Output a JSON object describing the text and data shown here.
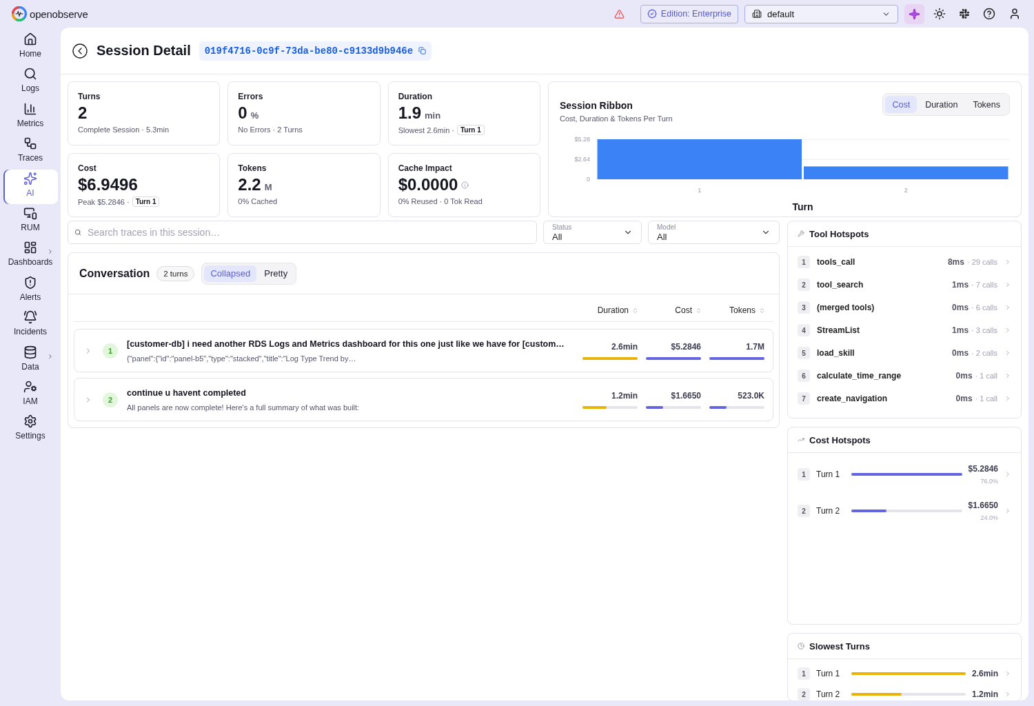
{
  "topbar": {
    "logo": "openobserve",
    "edition": "Edition: Enterprise",
    "organization": "default"
  },
  "sidebar": {
    "items": [
      {
        "label": "Home",
        "selected": false,
        "submenu": false
      },
      {
        "label": "Logs",
        "selected": false,
        "submenu": false
      },
      {
        "label": "Metrics",
        "selected": false,
        "submenu": false
      },
      {
        "label": "Traces",
        "selected": false,
        "submenu": false
      },
      {
        "label": "AI",
        "selected": true,
        "submenu": false
      },
      {
        "label": "RUM",
        "selected": false,
        "submenu": false
      },
      {
        "label": "Dashboards",
        "selected": false,
        "submenu": true
      },
      {
        "label": "Alerts",
        "selected": false,
        "submenu": false
      },
      {
        "label": "Incidents",
        "selected": false,
        "submenu": false
      },
      {
        "label": "Data",
        "selected": false,
        "submenu": true
      },
      {
        "label": "IAM",
        "selected": false,
        "submenu": false
      },
      {
        "label": "Settings",
        "selected": false,
        "submenu": false
      }
    ]
  },
  "header": {
    "title": "Session Detail",
    "session_id": "019f4716-0c9f-73da-be80-c9133d9b946e"
  },
  "stats": [
    {
      "label": "Turns",
      "value": "2",
      "detail": "Complete Session · 5.3min",
      "info": false
    },
    {
      "label": "Errors",
      "value": "0",
      "unit": "%",
      "detail": "No Errors · 2 Turns",
      "info": false
    },
    {
      "label": "Duration",
      "value": "1.9",
      "unit": "min",
      "detail": "Slowest 2.6min ·",
      "tag": "Turn 1",
      "info": false
    },
    {
      "label": "Cost",
      "value": "$6.9496",
      "detail": "Peak $5.2846 ·",
      "tag": "Turn 1",
      "info": false
    },
    {
      "label": "Tokens",
      "value": "2.2",
      "unit": "M",
      "detail": "0% Cached",
      "info": false
    },
    {
      "label": "Cache Impact",
      "value": "$0.0000",
      "detail": "0% Reused · 0 Tok Read",
      "info": true
    }
  ],
  "ribbon": {
    "title": "Session Ribbon",
    "subtitle": "Cost, Duration & Tokens Per Turn",
    "tabs": [
      {
        "label": "Cost",
        "selected": true
      },
      {
        "label": "Duration",
        "selected": false
      },
      {
        "label": "Tokens",
        "selected": false
      }
    ],
    "chart_data": {
      "type": "bar",
      "xlabel": "Turn",
      "categories": [
        "1",
        "2"
      ],
      "series": [
        {
          "color": "#3b82f6",
          "values": [
            5.3,
            1.7
          ]
        }
      ],
      "ylim": [
        0,
        5.3
      ],
      "yticks": [
        {
          "value": 0,
          "label": "0"
        },
        {
          "value": 2.64,
          "label": "$2.64"
        },
        {
          "value": 5.28,
          "label": "$5.28"
        }
      ]
    }
  },
  "filters": {
    "search": {
      "placeholder": "Search traces in this session…"
    },
    "status": {
      "label": "Status",
      "value": "All"
    },
    "model": {
      "label": "Model",
      "value": "All"
    }
  },
  "conversation": {
    "title": "Conversation",
    "count": "2 turns",
    "views": [
      {
        "label": "Collapsed",
        "selected": true
      },
      {
        "label": "Pretty",
        "selected": false
      }
    ],
    "columns": [
      "Duration",
      "Cost",
      "Tokens"
    ],
    "turns": [
      {
        "number": "1",
        "expanded": false,
        "title": "[customer-db] i need another RDS Logs and Metrics dashboard for this one just like we have for [custom…",
        "preview": "{\"panel\":{\"id\":\"panel-b5\",\"type\":\"stacked\",\"title\":\"Log Type Trend by…",
        "metrics": [
          {
            "value": "2.6min",
            "level": 1,
            "color": "#eab308"
          },
          {
            "value": "$5.2846",
            "level": 1,
            "color": "#6366e0"
          },
          {
            "value": "1.7M",
            "level": 1,
            "color": "#6366e0"
          }
        ]
      },
      {
        "number": "2",
        "expanded": false,
        "title": "continue u havent completed",
        "preview": "All panels are now complete! Here's a full summary of what was built:",
        "metrics": [
          {
            "value": "1.2min",
            "level": 0.44,
            "color": "#eab308"
          },
          {
            "value": "$1.6650",
            "level": 0.315,
            "color": "#6366e0"
          },
          {
            "value": "523.0K",
            "level": 0.31,
            "color": "#6366e0"
          }
        ]
      }
    ]
  },
  "tool_hotspots": {
    "title": "Tool Hotspots",
    "rows": [
      {
        "rank": "1",
        "name": "tools_call",
        "time": "8ms",
        "calls": "· 29 calls"
      },
      {
        "rank": "2",
        "name": "tool_search",
        "time": "1ms",
        "calls": "· 7 calls"
      },
      {
        "rank": "3",
        "name": "(merged tools)",
        "time": "0ms",
        "calls": "· 6 calls"
      },
      {
        "rank": "4",
        "name": "StreamList",
        "time": "1ms",
        "calls": "· 3 calls"
      },
      {
        "rank": "5",
        "name": "load_skill",
        "time": "0ms",
        "calls": "· 2 calls"
      },
      {
        "rank": "6",
        "name": "calculate_time_range",
        "time": "0ms",
        "calls": "· 1 call"
      },
      {
        "rank": "7",
        "name": "create_navigation",
        "time": "0ms",
        "calls": "· 1 call"
      }
    ]
  },
  "cost_hotspots": {
    "title": "Cost Hotspots",
    "rows": [
      {
        "rank": "1",
        "label": "Turn 1",
        "level": 1,
        "value": "$5.2846",
        "share": "76.0%"
      },
      {
        "rank": "2",
        "label": "Turn 2",
        "level": 0.315,
        "value": "$1.6650",
        "share": "24.0%"
      }
    ]
  },
  "slowest_turns": {
    "title": "Slowest Turns",
    "rows": [
      {
        "rank": "1",
        "label": "Turn 1",
        "level": 1,
        "value": "2.6min"
      },
      {
        "rank": "2",
        "label": "Turn 2",
        "level": 0.44,
        "value": "1.2min"
      }
    ]
  }
}
